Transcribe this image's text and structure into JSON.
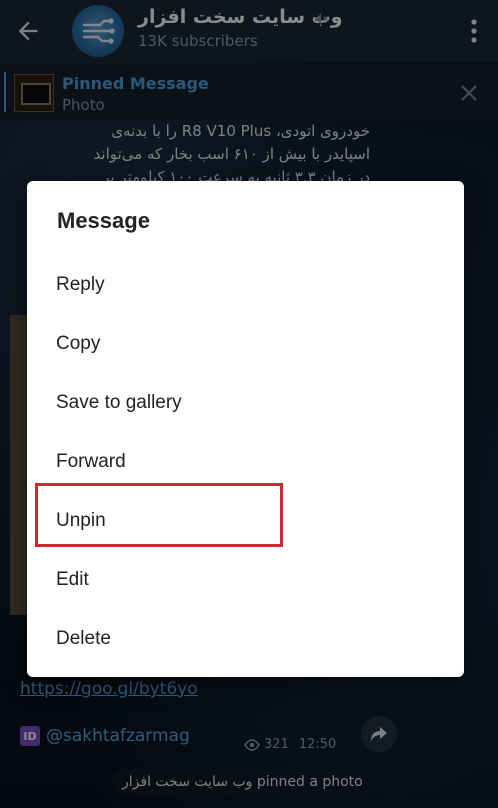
{
  "header": {
    "title": "وب سایت سخت افزار",
    "subtitle": "13K subscribers"
  },
  "pinned": {
    "title": "Pinned Message",
    "subtitle": "Photo"
  },
  "chat": {
    "lines": [
      "خودروی اتودی، R8 V10 Plus را با بدنه‌ی",
      "اسپایدر با بیش از ۶۱۰ اسب بخار که می‌تواند",
      "در زمان ۳.۳ ثانیه به سرعت ۱۰۰ کیلومتر بر"
    ],
    "link": "https://goo.gl/byt6yo",
    "id_badge": "ID",
    "handle": "@sakhtafzarmag",
    "views": "321",
    "time": "12:50",
    "service_message": "وب سایت سخت افزار pinned a photo"
  },
  "dialog": {
    "title": "Message",
    "items": [
      "Reply",
      "Copy",
      "Save to gallery",
      "Forward",
      "Unpin",
      "Edit",
      "Delete"
    ]
  },
  "icons": {
    "back": "arrow-left-icon",
    "mute": "muted-speaker-icon",
    "more": "more-vertical-icon",
    "close": "close-icon",
    "eye": "eye-icon",
    "share": "share-arrow-icon"
  },
  "colors": {
    "accent": "#4da3e6",
    "highlight_box": "#d42633",
    "header_bg": "#1c2733"
  }
}
